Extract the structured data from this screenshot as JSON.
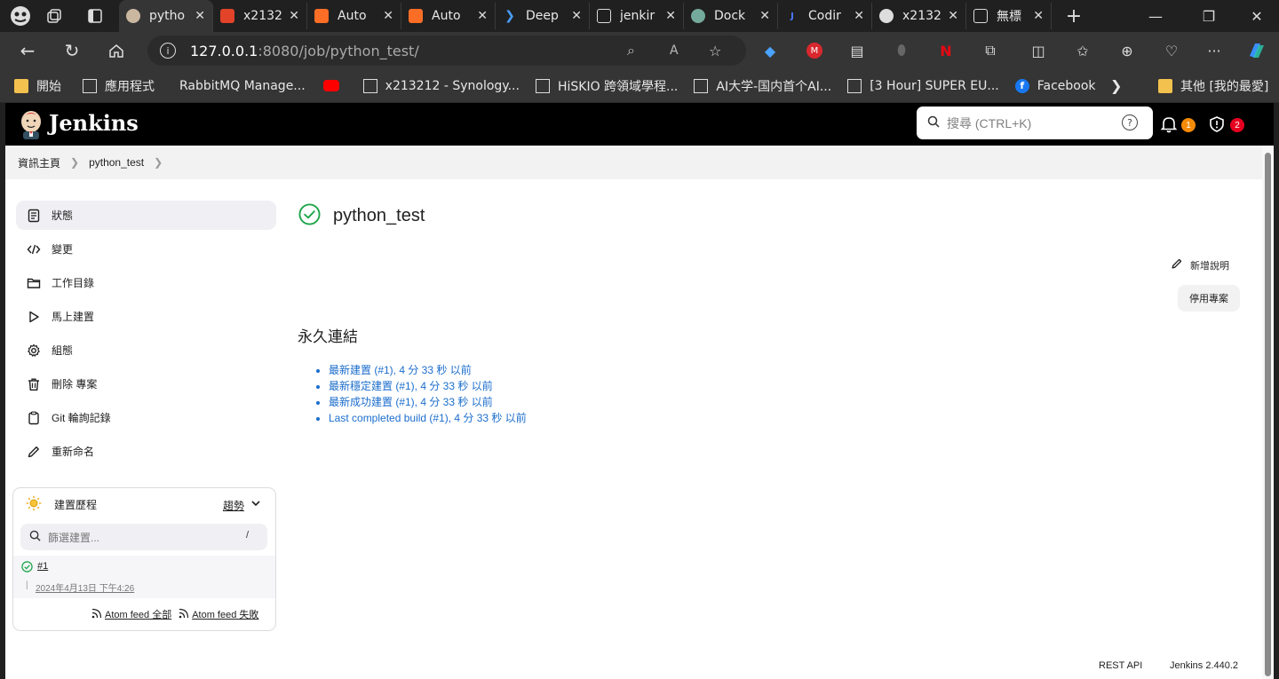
{
  "browser": {
    "tabs": [
      {
        "title": "pytho",
        "active": true
      },
      {
        "title": "x2132"
      },
      {
        "title": "Auto"
      },
      {
        "title": "Auto"
      },
      {
        "title": "Deep"
      },
      {
        "title": "jenkir"
      },
      {
        "title": "Dock"
      },
      {
        "title": "Codir"
      },
      {
        "title": "x2132"
      },
      {
        "title": "無標"
      }
    ],
    "url_host": "127.0.0.1",
    "url_path": ":8080/job/python_test/",
    "bookmarks": [
      "開始",
      "應用程式",
      "RabbitMQ Manage...",
      "x213212 - Synology...",
      "HiSKIO 跨領域學程...",
      "AI大学-国内首个AI...",
      "[3 Hour] SUPER EU...",
      "Facebook"
    ],
    "other_bookmarks": "其他 [我的最愛]"
  },
  "jenkins": {
    "brand": "Jenkins",
    "search_placeholder": "搜尋 (CTRL+K)",
    "notif_count": "1",
    "security_count": "2",
    "breadcrumb": [
      "資訊主頁",
      "python_test"
    ],
    "sidebar": [
      {
        "label": "狀態",
        "icon": "status-icon"
      },
      {
        "label": "變更",
        "icon": "code-icon"
      },
      {
        "label": "工作目錄",
        "icon": "folder-icon"
      },
      {
        "label": "馬上建置",
        "icon": "play-icon"
      },
      {
        "label": "組態",
        "icon": "gear-icon"
      },
      {
        "label": "刪除 專案",
        "icon": "trash-icon"
      },
      {
        "label": "Git 輪詢記錄",
        "icon": "clipboard-icon"
      },
      {
        "label": "重新命名",
        "icon": "pencil-icon"
      }
    ],
    "job_title": "python_test",
    "add_description": "新增說明",
    "disable_project": "停用專案",
    "permalinks_heading": "永久連結",
    "permalinks": [
      "最新建置 (#1), 4 分 33 秒 以前",
      "最新穩定建置 (#1), 4 分 33 秒 以前",
      "最新成功建置 (#1), 4 分 33 秒 以前",
      "Last completed build (#1), 4 分 33 秒 以前"
    ],
    "build_history": {
      "title": "建置歷程",
      "trend": "趨勢",
      "filter_placeholder": "篩選建置...",
      "filter_shortcut": "/",
      "builds": [
        {
          "number": "#1",
          "date": "2024年4月13日 下午4:26",
          "status": "success"
        }
      ],
      "atom_all": "Atom feed 全部",
      "atom_fail": "Atom feed 失敗"
    },
    "footer": {
      "rest_api": "REST API",
      "version": "Jenkins 2.440.2"
    },
    "colors": {
      "header_bg": "#000000",
      "link": "#1b6dcc",
      "success": "#1ea64b",
      "notif_badge": "#f58a07",
      "security_badge": "#e6001f"
    }
  }
}
